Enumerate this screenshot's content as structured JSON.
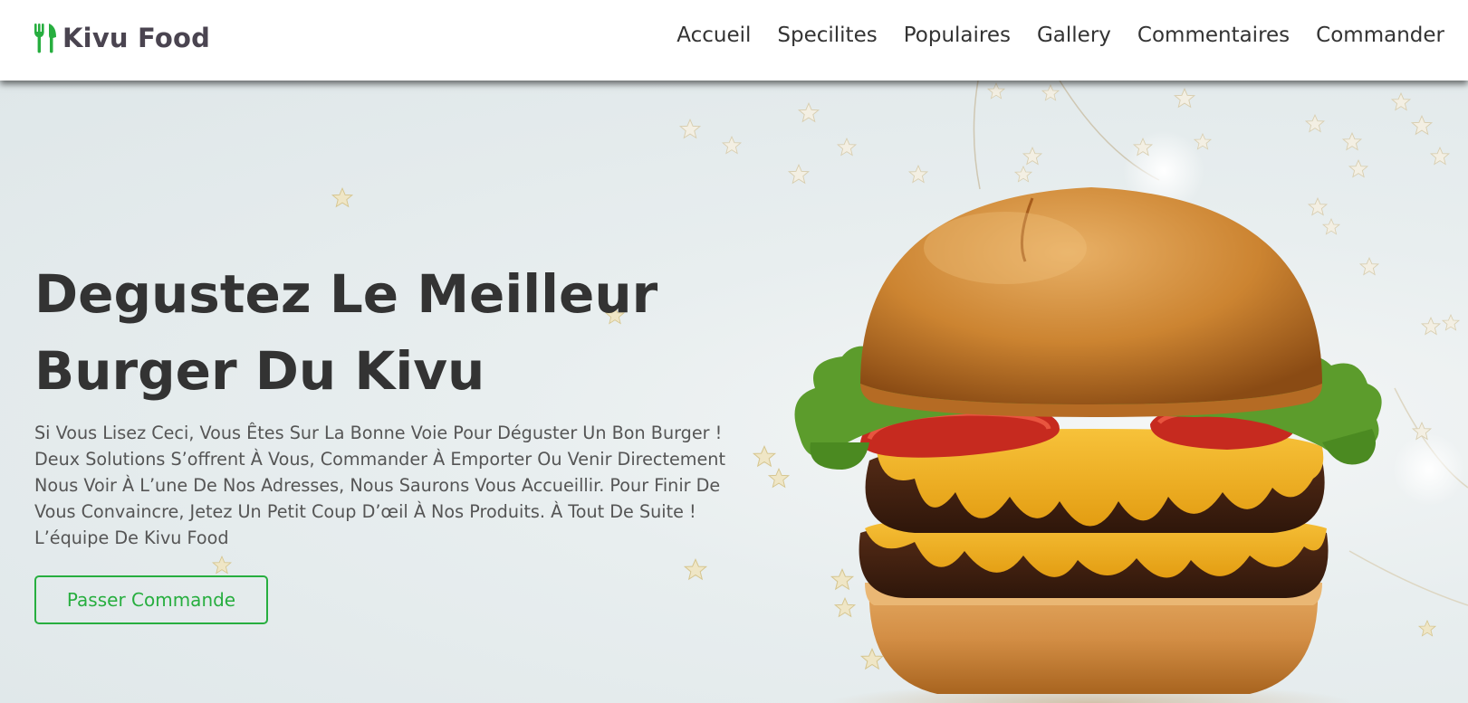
{
  "header": {
    "logo_text": "Kivu Food",
    "logo_icon": "utensils-icon",
    "nav": [
      {
        "label": "Accueil"
      },
      {
        "label": "Specilites"
      },
      {
        "label": "Populaires"
      },
      {
        "label": "Gallery"
      },
      {
        "label": "Commentaires"
      },
      {
        "label": "Commander"
      }
    ]
  },
  "hero": {
    "title_line1": "Degustez Le Meilleur",
    "title_line2": "Burger Du Kivu",
    "description_lines": [
      "Si Vous Lisez Ceci, Vous Êtes Sur La Bonne Voie Pour Déguster Un Bon Burger !",
      "Deux Solutions S’offrent À Vous, Commander À Emporter Ou Venir Directement",
      "Nous Voir À L’une De Nos Adresses, Nous Saurons Vous Accueillir. Pour Finir De",
      "Vous Convaincre, Jetez Un Petit Coup D’œil À Nos Produits. À Tout De Suite !",
      "L’équipe De Kivu Food"
    ],
    "cta_label": "Passer Commande",
    "image": "burger-image"
  },
  "colors": {
    "accent": "#27ae3f",
    "text_dark": "#333333",
    "text_body": "#555555",
    "logo_text": "#4a4450"
  }
}
